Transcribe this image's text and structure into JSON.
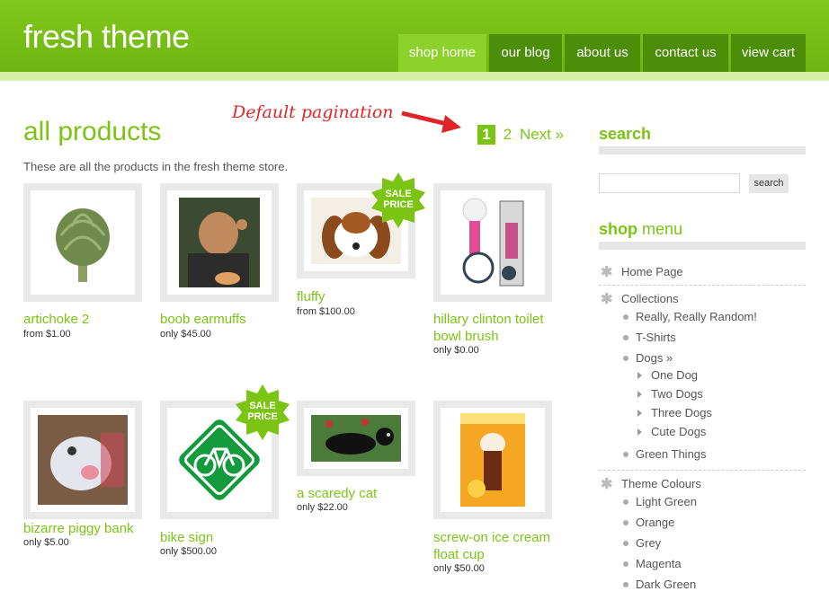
{
  "brand": {
    "name": "fresh theme",
    "accent": "#7cc414",
    "header_dark": "#4c8e0a"
  },
  "nav": [
    {
      "label": "shop home",
      "active": true
    },
    {
      "label": "our blog"
    },
    {
      "label": "about us"
    },
    {
      "label": "contact us"
    },
    {
      "label": "view cart"
    }
  ],
  "main": {
    "title": "all products",
    "intro": "These are all the products in the fresh theme store.",
    "annotation": "Default pagination",
    "pagination": {
      "current": "1",
      "next_page": "2",
      "next": "Next »"
    },
    "products": [
      {
        "name": "artichoke 2",
        "price": "from $1.00",
        "image": "artichoke-image"
      },
      {
        "name": "boob earmuffs",
        "price": "only $45.00",
        "image": "man-earmuffs-image"
      },
      {
        "name": "fluffy",
        "price": "from $100.00",
        "image": "puppy-image",
        "badge": [
          "SALE",
          "PRICE"
        ]
      },
      {
        "name": [
          "hillary clinton toilet",
          "bowl brush"
        ],
        "price": "only $0.00",
        "image": "toilet-brush-image"
      },
      {
        "name": "bizarre piggy bank",
        "price": "only $5.00",
        "image": "piggy-bank-image"
      },
      {
        "name": "bike sign",
        "price": "only $500.00",
        "image": "bike-sign-image",
        "badge": [
          "SALE",
          "PRICE"
        ]
      },
      {
        "name": "a scaredy cat",
        "price": "only $22.00",
        "image": "black-cat-image"
      },
      {
        "name": [
          "screw-on ice cream",
          "float cup"
        ],
        "price": "only $50.00",
        "image": "float-cup-image"
      }
    ]
  },
  "sidebar": {
    "search_heading": "search",
    "search_value": "",
    "search_button": "search",
    "menu_heading_bold": "shop",
    "menu_heading_rest": " menu",
    "home": "Home Page",
    "collections": "Collections",
    "collections_items": [
      "Really, Really Random!",
      "T-Shirts",
      "Dogs »",
      "Green Things"
    ],
    "dogs_items": [
      "One Dog",
      "Two Dogs",
      "Three Dogs",
      "Cute Dogs"
    ],
    "colours": "Theme Colours",
    "colours_items": [
      "Light Green",
      "Orange",
      "Grey",
      "Magenta",
      "Dark Green"
    ]
  }
}
